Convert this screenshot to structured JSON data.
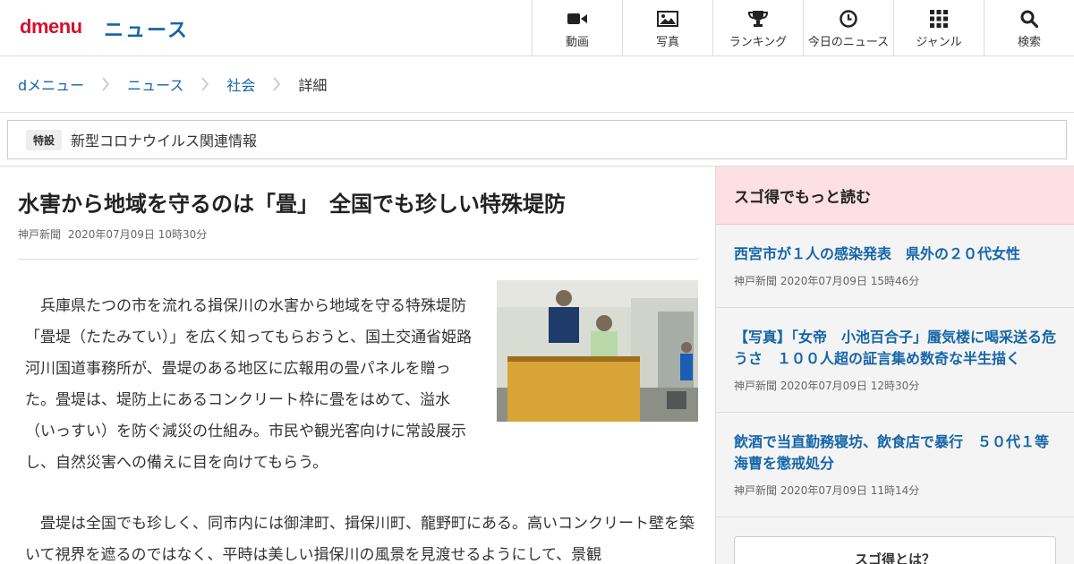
{
  "header": {
    "logo": "dmenu",
    "section": "ニュース",
    "nav": [
      {
        "label": "動画",
        "icon": "video-icon"
      },
      {
        "label": "写真",
        "icon": "photo-icon"
      },
      {
        "label": "ランキング",
        "icon": "trophy-icon"
      },
      {
        "label": "今日のニュース",
        "icon": "clock-icon"
      },
      {
        "label": "ジャンル",
        "icon": "grid-icon"
      },
      {
        "label": "検索",
        "icon": "search-icon"
      }
    ]
  },
  "breadcrumb": [
    "dメニュー",
    "ニュース",
    "社会",
    "詳細"
  ],
  "special": {
    "tag": "特設",
    "text": "新型コロナウイルス関連情報"
  },
  "article": {
    "title": "水害から地域を守るのは「畳」　全国でも珍しい特殊堤防",
    "source": "神戸新聞",
    "date": "2020年07月09日 10時30分",
    "paragraph1": "　兵庫県たつの市を流れる揖保川の水害から地域を守る特殊堤防「畳堤（たたみてい）」を広く知ってもらおうと、国土交通省姫路河川国道事務所が、畳堤のある地区に広報用の畳パネルを贈った。畳堤は、堤防上にあるコンクリート枠に畳をはめて、溢水（いっすい）を防ぐ減災の仕組み。市民や観光客向けに常設展示し、自然災害への備えに目を向けてもらう。",
    "paragraph2": "　畳堤は全国でも珍しく、同市内には御津町、揖保川町、龍野町にある。高いコンクリート壁を築いて視界を遮るのではなく、平時は美しい揖保川の風景を見渡せるようにして、景観"
  },
  "sidebar": {
    "heading": "スゴ得でもっと読む",
    "items": [
      {
        "title": "西宮市が１人の感染発表　県外の２０代女性",
        "source": "神戸新聞",
        "date": "2020年07月09日 15時46分"
      },
      {
        "title": "【写真】「女帝　小池百合子」蜃気楼に喝采送る危うさ　１００人超の証言集め数奇な半生描く",
        "source": "神戸新聞",
        "date": "2020年07月09日 12時30分"
      },
      {
        "title": "飲酒で当直勤務寝坊、飲食店で暴行　５０代１等海曹を懲戒処分",
        "source": "神戸新聞",
        "date": "2020年07月09日 11時14分"
      }
    ],
    "about_button": "スゴ得とは？"
  },
  "colors": {
    "brand_red": "#d5102f",
    "link_blue": "#1565a8",
    "sidebar_head": "#fde0e3"
  }
}
